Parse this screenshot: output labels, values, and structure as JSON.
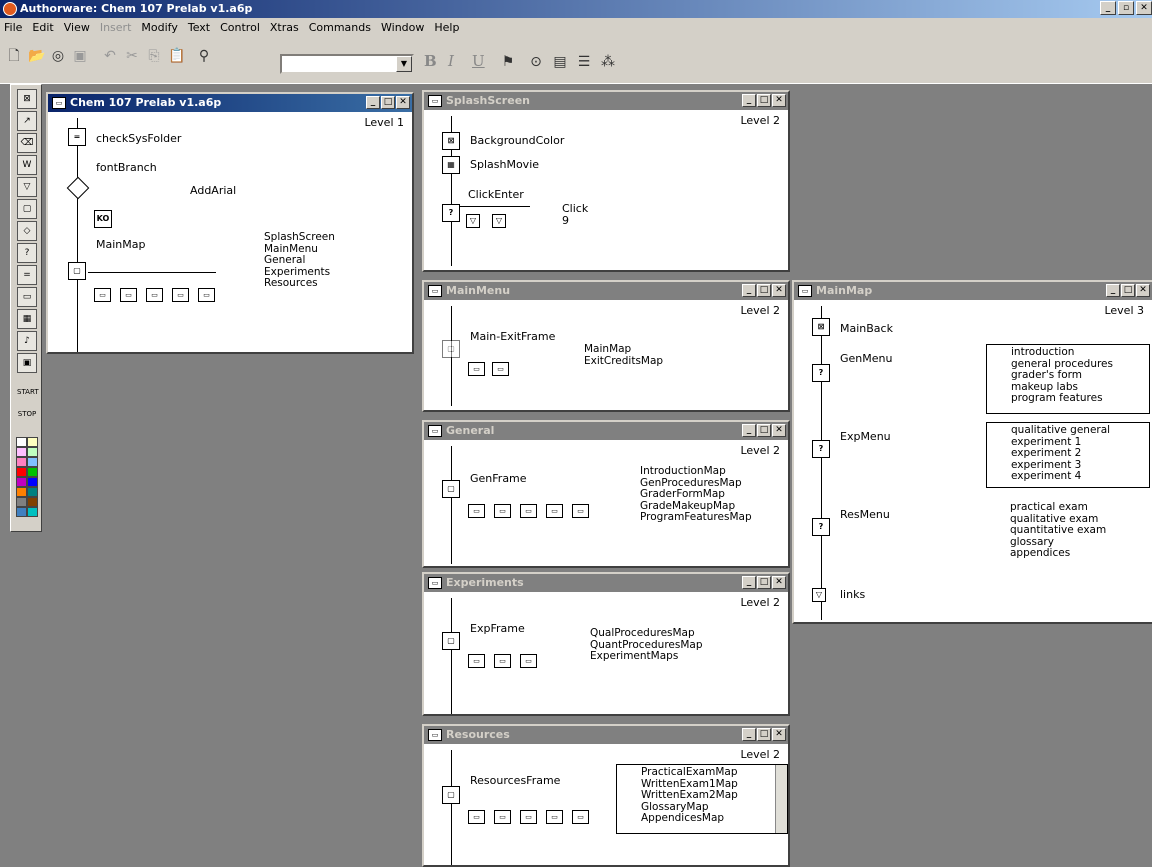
{
  "app": {
    "title": "Authorware: Chem 107 Prelab v1.a6p"
  },
  "menu": [
    "File",
    "Edit",
    "View",
    "Insert",
    "Modify",
    "Text",
    "Control",
    "Xtras",
    "Commands",
    "Window",
    "Help"
  ],
  "toolbar": {
    "bold": "B",
    "italic": "I",
    "underline": "U"
  },
  "windows": {
    "main": {
      "title": "Chem 107 Prelab v1.a6p",
      "level": "Level 1",
      "labels": {
        "checkSys": "checkSysFolder",
        "fontBranch": "fontBranch",
        "addArial": "AddArial",
        "mainMap": "MainMap"
      },
      "list": [
        "SplashScreen",
        "MainMenu",
        "General",
        "Experiments",
        "Resources"
      ]
    },
    "splash": {
      "title": "SplashScreen",
      "level": "Level 2",
      "labels": {
        "bg": "BackgroundColor",
        "movie": "SplashMovie",
        "click": "ClickEnter",
        "click2": "Click",
        "nine": "9"
      }
    },
    "mainmenu": {
      "title": "MainMenu",
      "level": "Level 2",
      "labels": {
        "exit": "Main-ExitFrame"
      },
      "list": [
        "MainMap",
        "ExitCreditsMap"
      ]
    },
    "general": {
      "title": "General",
      "level": "Level 2",
      "labels": {
        "frame": "GenFrame"
      },
      "list": [
        "IntroductionMap",
        "GenProceduresMap",
        "GraderFormMap",
        "GradeMakeupMap",
        "ProgramFeaturesMap"
      ]
    },
    "experiments": {
      "title": "Experiments",
      "level": "Level 2",
      "labels": {
        "frame": "ExpFrame"
      },
      "list": [
        "QualProceduresMap",
        "QuantProceduresMap",
        "ExperimentMaps"
      ]
    },
    "resources": {
      "title": "Resources",
      "level": "Level 2",
      "labels": {
        "frame": "ResourcesFrame"
      },
      "list": [
        "PracticalExamMap",
        "WrittenExam1Map",
        "WrittenExam2Map",
        "GlossaryMap",
        "AppendicesMap"
      ]
    },
    "mainmap": {
      "title": "MainMap",
      "level": "Level 3",
      "labels": {
        "back": "MainBack",
        "gen": "GenMenu",
        "exp": "ExpMenu",
        "res": "ResMenu",
        "links": "links"
      },
      "genlist": [
        "introduction",
        "general procedures",
        "grader's form",
        "makeup labs",
        "program features"
      ],
      "explist": [
        "qualitative general",
        "experiment 1",
        "experiment 2",
        "experiment 3",
        "experiment 4"
      ],
      "reslist": [
        "practical exam",
        "qualitative exam",
        "quantitative exam",
        "glossary",
        "appendices"
      ]
    }
  }
}
